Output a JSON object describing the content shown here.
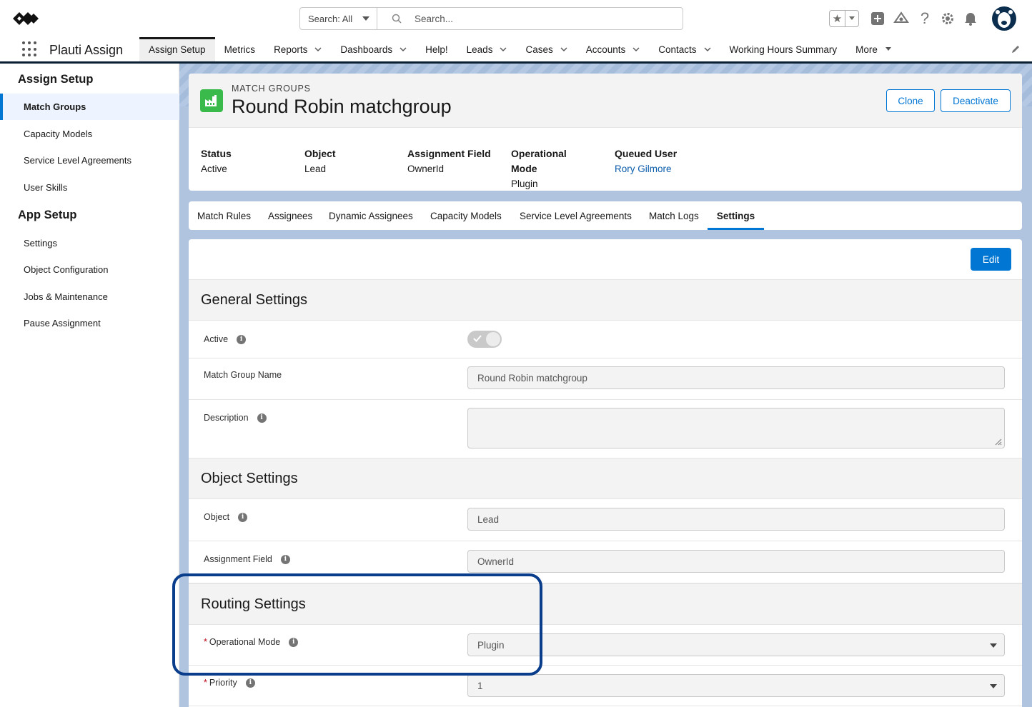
{
  "global_header": {
    "search_scope": "Search: All",
    "search_placeholder": "Search..."
  },
  "app_nav": {
    "app_name": "Plauti Assign",
    "items": [
      {
        "label": "Assign Setup",
        "active": true,
        "has_menu": false
      },
      {
        "label": "Metrics",
        "has_menu": false
      },
      {
        "label": "Reports",
        "has_menu": true
      },
      {
        "label": "Dashboards",
        "has_menu": true
      },
      {
        "label": "Help!",
        "has_menu": false
      },
      {
        "label": "Leads",
        "has_menu": true
      },
      {
        "label": "Cases",
        "has_menu": true
      },
      {
        "label": "Accounts",
        "has_menu": true
      },
      {
        "label": "Contacts",
        "has_menu": true
      },
      {
        "label": "Working Hours Summary",
        "has_menu": false
      },
      {
        "label": "More",
        "has_menu": true
      }
    ]
  },
  "sidebar": {
    "assign_setup_title": "Assign Setup",
    "assign_items": [
      "Match Groups",
      "Capacity Models",
      "Service Level Agreements",
      "User Skills"
    ],
    "app_setup_title": "App Setup",
    "app_items": [
      "Settings",
      "Object Configuration",
      "Jobs & Maintenance",
      "Pause Assignment"
    ]
  },
  "record": {
    "object_label": "MATCH GROUPS",
    "title": "Round Robin matchgroup",
    "clone_label": "Clone",
    "deactivate_label": "Deactivate",
    "fields": {
      "status_label": "Status",
      "status_value": "Active",
      "object_label": "Object",
      "object_value": "Lead",
      "assignment_field_label": "Assignment Field",
      "assignment_field_value": "OwnerId",
      "operational_mode_label_1": "Operational",
      "operational_mode_label_2": "Mode",
      "operational_mode_value": "Plugin",
      "queued_user_label": "Queued User",
      "queued_user_value": "Rory Gilmore"
    }
  },
  "tabs": [
    "Match Rules",
    "Assignees",
    "Dynamic Assignees",
    "Capacity Models",
    "Service Level Agreements",
    "Match Logs",
    "Settings"
  ],
  "settings": {
    "edit_label": "Edit",
    "general_title": "General Settings",
    "active_label": "Active",
    "active_value": true,
    "name_label": "Match Group Name",
    "name_value": "Round Robin matchgroup",
    "description_label": "Description",
    "description_value": "",
    "object_section_title": "Object Settings",
    "object_label": "Object",
    "object_value": "Lead",
    "assignment_field_label": "Assignment Field",
    "assignment_field_value": "OwnerId",
    "routing_title": "Routing Settings",
    "operational_mode_label": "Operational Mode",
    "operational_mode_value": "Plugin",
    "priority_label": "Priority",
    "priority_value": "1",
    "required_marker": "*",
    "info_glyph": "i"
  },
  "colors": {
    "brand_blue": "#0176d3",
    "link_blue": "#0b5cab",
    "highlight_border": "#0a3e8c",
    "record_icon_green": "#3bba4c"
  }
}
